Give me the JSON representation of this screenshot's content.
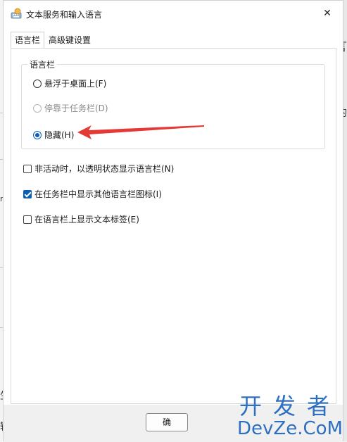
{
  "window": {
    "title": "文本服务和输入语言",
    "close_glyph": "✕"
  },
  "tabs": [
    {
      "label": "语言栏",
      "active": true
    },
    {
      "label": "高级键设置",
      "active": false
    }
  ],
  "language_bar_group": {
    "legend": "语言栏",
    "options": [
      {
        "label": "悬浮于桌面上(F)",
        "state": "unchecked"
      },
      {
        "label": "停靠于任务栏(D)",
        "state": "disabled"
      },
      {
        "label": "隐藏(H)",
        "state": "checked"
      }
    ]
  },
  "checkboxes": [
    {
      "label": "非活动时，以透明状态显示语言栏(N)",
      "checked": false
    },
    {
      "label": "在任务栏中显示其他语言栏图标(I)",
      "checked": true
    },
    {
      "label": "在语言栏上显示文本标签(E)",
      "checked": false
    }
  ],
  "footer": {
    "ok_label": "确"
  },
  "annotation": {
    "arrow_color": "#e53935"
  },
  "watermark": {
    "line1": "开发者",
    "line2": "DevZe.CoM"
  },
  "background": {
    "glyph_right_1": "言",
    "glyph_right_2": "的",
    "glyph_left_1": "n",
    "glyph_left_2": "生",
    "glyph_left_3": "输"
  },
  "colors": {
    "accent": "#0a5fb4",
    "watermark": "#2d6fc0"
  }
}
